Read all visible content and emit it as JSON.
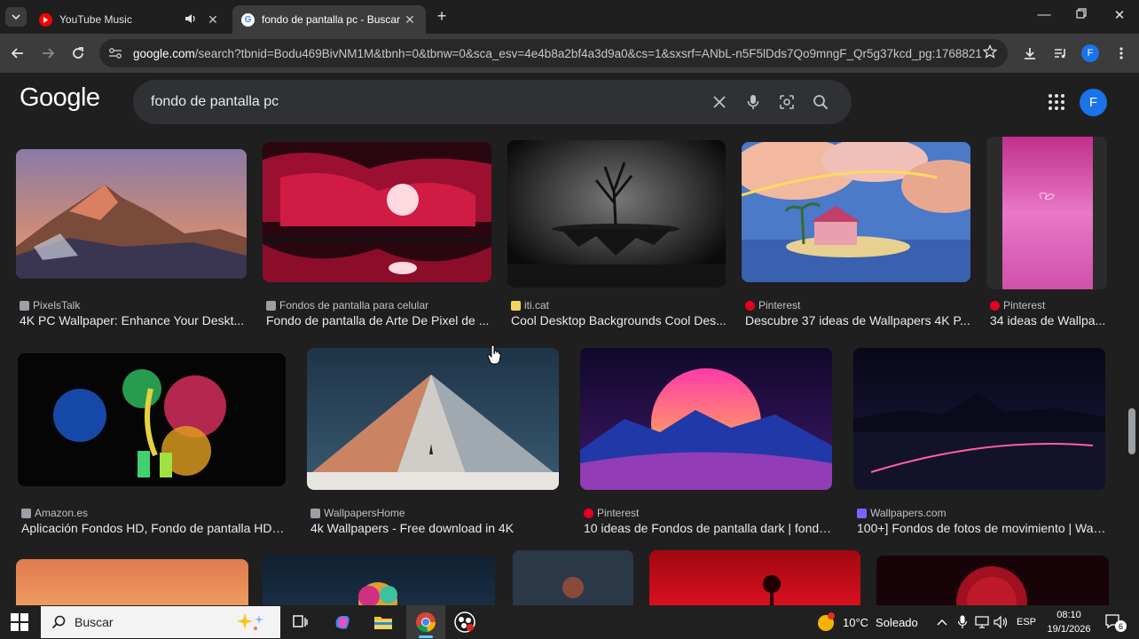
{
  "tabs": [
    {
      "title": "YouTube Music",
      "active": false,
      "icon": "youtube-music-icon",
      "audio": true
    },
    {
      "title": "fondo de pantalla pc - Buscar con Google",
      "active": true,
      "icon": "google-icon",
      "audio": false
    }
  ],
  "toolbar": {
    "url_domain": "google.com",
    "url_path": "/search?tbnid=Bodu469BivNM1M&tbnh=0&tbnw=0&sca_esv=4e4b8a2bf4a3d9a0&cs=1&sxsrf=ANbL-n5F5lDds7Qo9mngF_Qr5g37kcd_pg:1768821..."
  },
  "header": {
    "logo": "Google",
    "query": "fondo de pantalla pc",
    "avatar_letter": "F"
  },
  "results": [
    {
      "source": "PixelsTalk",
      "title": "4K PC Wallpaper: Enhance Your Deskt...",
      "source_icon_color": "#9aa0a6"
    },
    {
      "source": "Fondos de pantalla para celular",
      "title": "Fondo de pantalla de Arte De Pixel de ...",
      "source_icon_color": "#9aa0a6"
    },
    {
      "source": "iti.cat",
      "title": "Cool Desktop Backgrounds Cool Des...",
      "source_icon_color": "#f4d35e"
    },
    {
      "source": "Pinterest",
      "title": "Descubre 37 ideas de Wallpapers 4K P...",
      "source_icon_color": "#e60023"
    },
    {
      "source": "Pinterest",
      "title": "34 ideas de Wallpa...",
      "source_icon_color": "#e60023"
    },
    {
      "source": "Amazon.es",
      "title": "Aplicación Fondos HD, Fondo de pantalla HD, ...",
      "source_icon_color": "#9aa0a6",
      "badge": "HD"
    },
    {
      "source": "WallpapersHome",
      "title": "4k Wallpapers - Free download in 4K",
      "source_icon_color": "#9aa0a6"
    },
    {
      "source": "Pinterest",
      "title": "10 ideas de Fondos de pantalla dark | fondo...",
      "source_icon_color": "#e60023"
    },
    {
      "source": "Wallpapers.com",
      "title": "100+] Fondos de fotos de movimiento | Wall...",
      "source_icon_color": "#7b61ff"
    }
  ],
  "taskbar": {
    "search_placeholder": "Buscar",
    "weather_temp": "10°C",
    "weather_text": "Soleado",
    "lang": "ESP",
    "time": "08:10",
    "date": "19/1/2026",
    "notifications": "6"
  }
}
